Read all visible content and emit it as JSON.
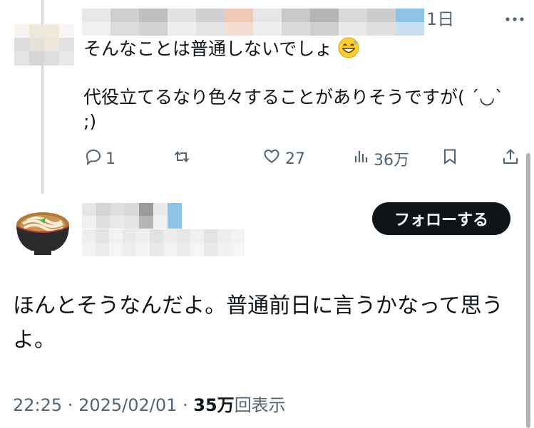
{
  "reply": {
    "time": "1日",
    "text": "そんなことは普通しないでしょ",
    "text2": "代役立てるなり色々することがありそうですが( ´◡`\n;)",
    "emoji_icon": "grinning-sweat-emoji",
    "actions": {
      "reply_count": "1",
      "retweet_count": "",
      "like_count": "27",
      "views_count": "36万"
    }
  },
  "main": {
    "follow_label": "フォローする",
    "text": "ほんとそうなんだよ。普通前日に言うかなって思うよ。",
    "meta": {
      "time": "22:25",
      "sep1": " · ",
      "date": "2025/02/01",
      "sep2": " · ",
      "views_num": "35万",
      "views_label": "回表示"
    }
  },
  "colors": {
    "text": "#0f1419",
    "secondary": "#536471",
    "thread_line": "#cfd9de",
    "button_bg": "#0f1419"
  }
}
